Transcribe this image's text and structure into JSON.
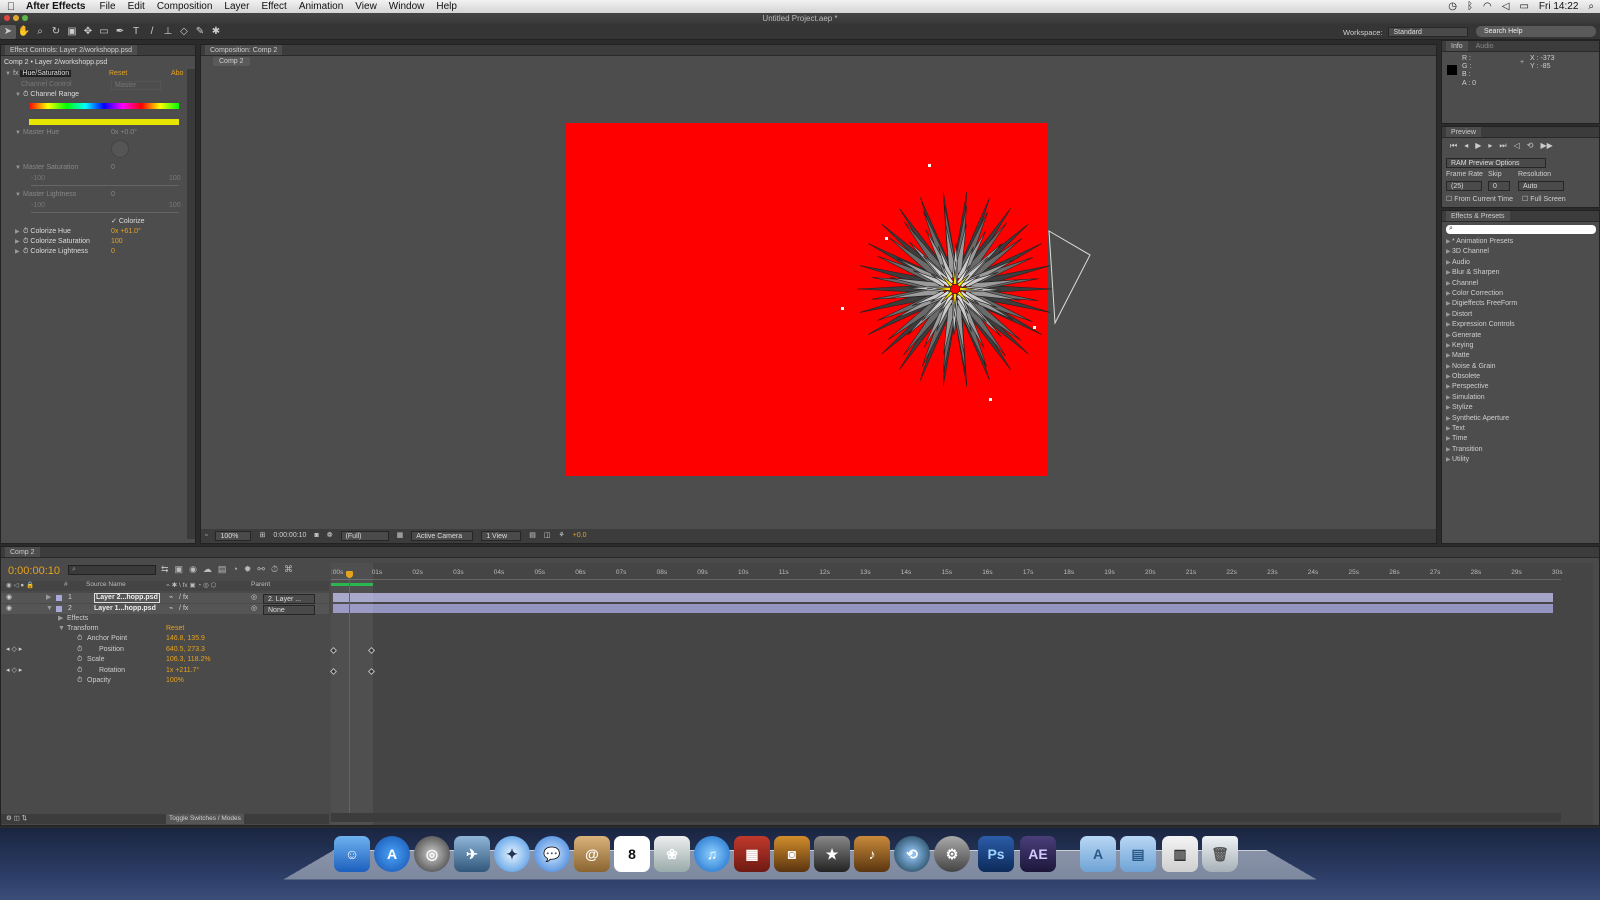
{
  "menubar": {
    "app_name": "After Effects",
    "items": [
      "File",
      "Edit",
      "Composition",
      "Layer",
      "Effect",
      "Animation",
      "View",
      "Window",
      "Help"
    ],
    "clock": "Fri 14:22"
  },
  "window": {
    "title": "Untitled Project.aep *"
  },
  "workspace": {
    "label": "Workspace:",
    "value": "Standard"
  },
  "search_help": {
    "placeholder": "Search Help"
  },
  "effect_controls": {
    "tab": "Effect Controls: Layer 2/workshopp.psd",
    "breadcrumb": "Comp 2 • Layer 2/workshopp.psd",
    "effect_name": "Hue/Saturation",
    "reset": "Reset",
    "about": "Abo",
    "channel_control_label": "Channel Control",
    "channel_control_value": "Master",
    "channel_range": "Channel Range",
    "master_hue_label": "Master Hue",
    "master_hue_value": "0x +0.0°",
    "master_saturation_label": "Master Saturation",
    "master_saturation_value": "0",
    "master_lightness_label": "Master Lightness",
    "master_lightness_value": "0",
    "slider_min": "-100",
    "slider_max": "100",
    "colorize_label": "Colorize",
    "colorize_hue_label": "Colorize Hue",
    "colorize_hue_value": "0x +61.0°",
    "colorize_saturation_label": "Colorize Saturation",
    "colorize_saturation_value": "100",
    "colorize_lightness_label": "Colorize Lightness",
    "colorize_lightness_value": "0"
  },
  "composition": {
    "tab": "Composition: Comp 2",
    "subtab": "Comp 2",
    "canvas_color": "#ff0000",
    "footer": {
      "zoom": "100%",
      "timecode": "0:00:00:10",
      "resolution": "(Full)",
      "camera": "Active Camera",
      "view": "1 View",
      "exposure": "+0.0"
    }
  },
  "info_panel": {
    "tabs": [
      "Info",
      "Audio"
    ],
    "r": "R :",
    "g": "G :",
    "b": "B :",
    "a": "A : 0",
    "x": "X : -373",
    "y": "Y : -85"
  },
  "preview_panel": {
    "tab": "Preview",
    "ram_options": "RAM Preview Options",
    "frame_rate_label": "Frame Rate",
    "skip_label": "Skip",
    "resolution_label": "Resolution",
    "frame_rate_value": "(25)",
    "skip_value": "0",
    "resolution_value": "Auto",
    "from_current_time": "From Current Time",
    "full_screen": "Full Screen"
  },
  "effects_presets": {
    "tab": "Effects & Presets",
    "items": [
      "* Animation Presets",
      "3D Channel",
      "Audio",
      "Blur & Sharpen",
      "Channel",
      "Color Correction",
      "Digieffects FreeForm",
      "Distort",
      "Expression Controls",
      "Generate",
      "Keying",
      "Matte",
      "Noise & Grain",
      "Obsolete",
      "Perspective",
      "Simulation",
      "Stylize",
      "Synthetic Aperture",
      "Text",
      "Time",
      "Transition",
      "Utility"
    ]
  },
  "timeline": {
    "tab": "Comp 2",
    "timecode": "0:00:00:10",
    "col_hash": "#",
    "col_source": "Source Name",
    "col_parent": "Parent",
    "ticks": [
      ":00s",
      "01s",
      "02s",
      "03s",
      "04s",
      "05s",
      "06s",
      "07s",
      "08s",
      "09s",
      "10s",
      "11s",
      "12s",
      "13s",
      "14s",
      "15s",
      "16s",
      "17s",
      "18s",
      "19s",
      "20s",
      "21s",
      "22s",
      "23s",
      "24s",
      "25s",
      "26s",
      "27s",
      "28s",
      "29s",
      "30s"
    ],
    "layers": [
      {
        "num": "1",
        "name": "Layer 2...hopp.psd",
        "parent": "2. Layer ..."
      },
      {
        "num": "2",
        "name": "Layer 1...hopp.psd",
        "parent": "None"
      }
    ],
    "props": {
      "effects": "Effects",
      "transform": "Transform",
      "transform_reset": "Reset",
      "anchor_label": "Anchor Point",
      "anchor_value": "146.8, 135.9",
      "position_label": "Position",
      "position_value": "640.5, 273.3",
      "scale_label": "Scale",
      "scale_value": "106.3, 118.2%",
      "rotation_label": "Rotation",
      "rotation_value": "1x +211.7°",
      "opacity_label": "Opacity",
      "opacity_value": "100%"
    },
    "toggle": "Toggle Switches / Modes"
  },
  "dock": {
    "ps_label": "Ps",
    "ae_label": "AE",
    "calendar_day": "8"
  }
}
